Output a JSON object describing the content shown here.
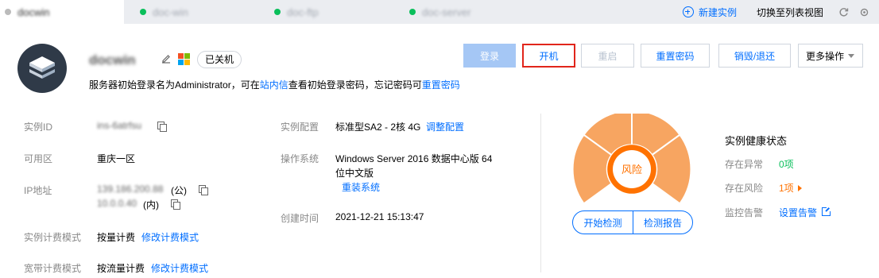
{
  "tabs": [
    {
      "label": "docwin",
      "active": true,
      "dot_color": "#bbbbbb"
    },
    {
      "label": "doc-win",
      "active": false,
      "dot_color": "#0abf5b"
    },
    {
      "label": "doc-ftp",
      "active": false,
      "dot_color": "#0abf5b"
    },
    {
      "label": "doc-server",
      "active": false,
      "dot_color": "#0abf5b"
    }
  ],
  "tab_actions": {
    "new_instance": "新建实例",
    "switch_view": "切换至列表视图",
    "refresh_icon": "refresh-icon",
    "settings_icon": "settings-icon"
  },
  "header": {
    "instance_name": "docwin",
    "os_icon": "windows-icon",
    "status": "已关机",
    "tip_prefix": "服务器初始登录名为Administrator，可在",
    "tip_link1": "站内信",
    "tip_middle": "查看初始登录密码，忘记密码可",
    "tip_link2": "重置密码"
  },
  "actions": {
    "login": "登录",
    "power_on": "开机",
    "restart": "重启",
    "reset_password": "重置密码",
    "destroy": "销毁/退还",
    "more": "更多操作"
  },
  "info": {
    "instance_id_label": "实例ID",
    "instance_id_value": "ins-6atrfsu",
    "zone_label": "可用区",
    "zone_value": "重庆一区",
    "ip_label": "IP地址",
    "ip_public": "139.186.200.88",
    "ip_public_tag": "(公)",
    "ip_private": "10.0.0.40",
    "ip_private_tag": "(内)",
    "billing_label": "实例计费模式",
    "billing_value": "按量计费",
    "billing_link": "修改计费模式",
    "bandwidth_label": "宽带计费模式",
    "bandwidth_value": "按流量计费",
    "bandwidth_link": "修改计费模式",
    "config_label": "实例配置",
    "config_value": "标准型SA2 - 2核 4G",
    "config_link": "调整配置",
    "os_label": "操作系统",
    "os_value_line1": "Windows Server 2016 数据中心版 64",
    "os_value_line2": "位中文版",
    "os_link": "重装系统",
    "created_label": "创建时间",
    "created_value": "2021-12-21 15:13:47"
  },
  "health": {
    "gauge_label": "风险",
    "start_check": "开始检测",
    "check_report": "检测报告",
    "title": "实例健康状态",
    "abnormal_label": "存在异常",
    "abnormal_value": "0项",
    "risk_label": "存在风险",
    "risk_value": "1项",
    "alarm_label": "监控告警",
    "alarm_link": "设置告警",
    "colors": {
      "risk": "#ff7200",
      "ok": "#0abf5b",
      "link": "#006eff"
    }
  }
}
